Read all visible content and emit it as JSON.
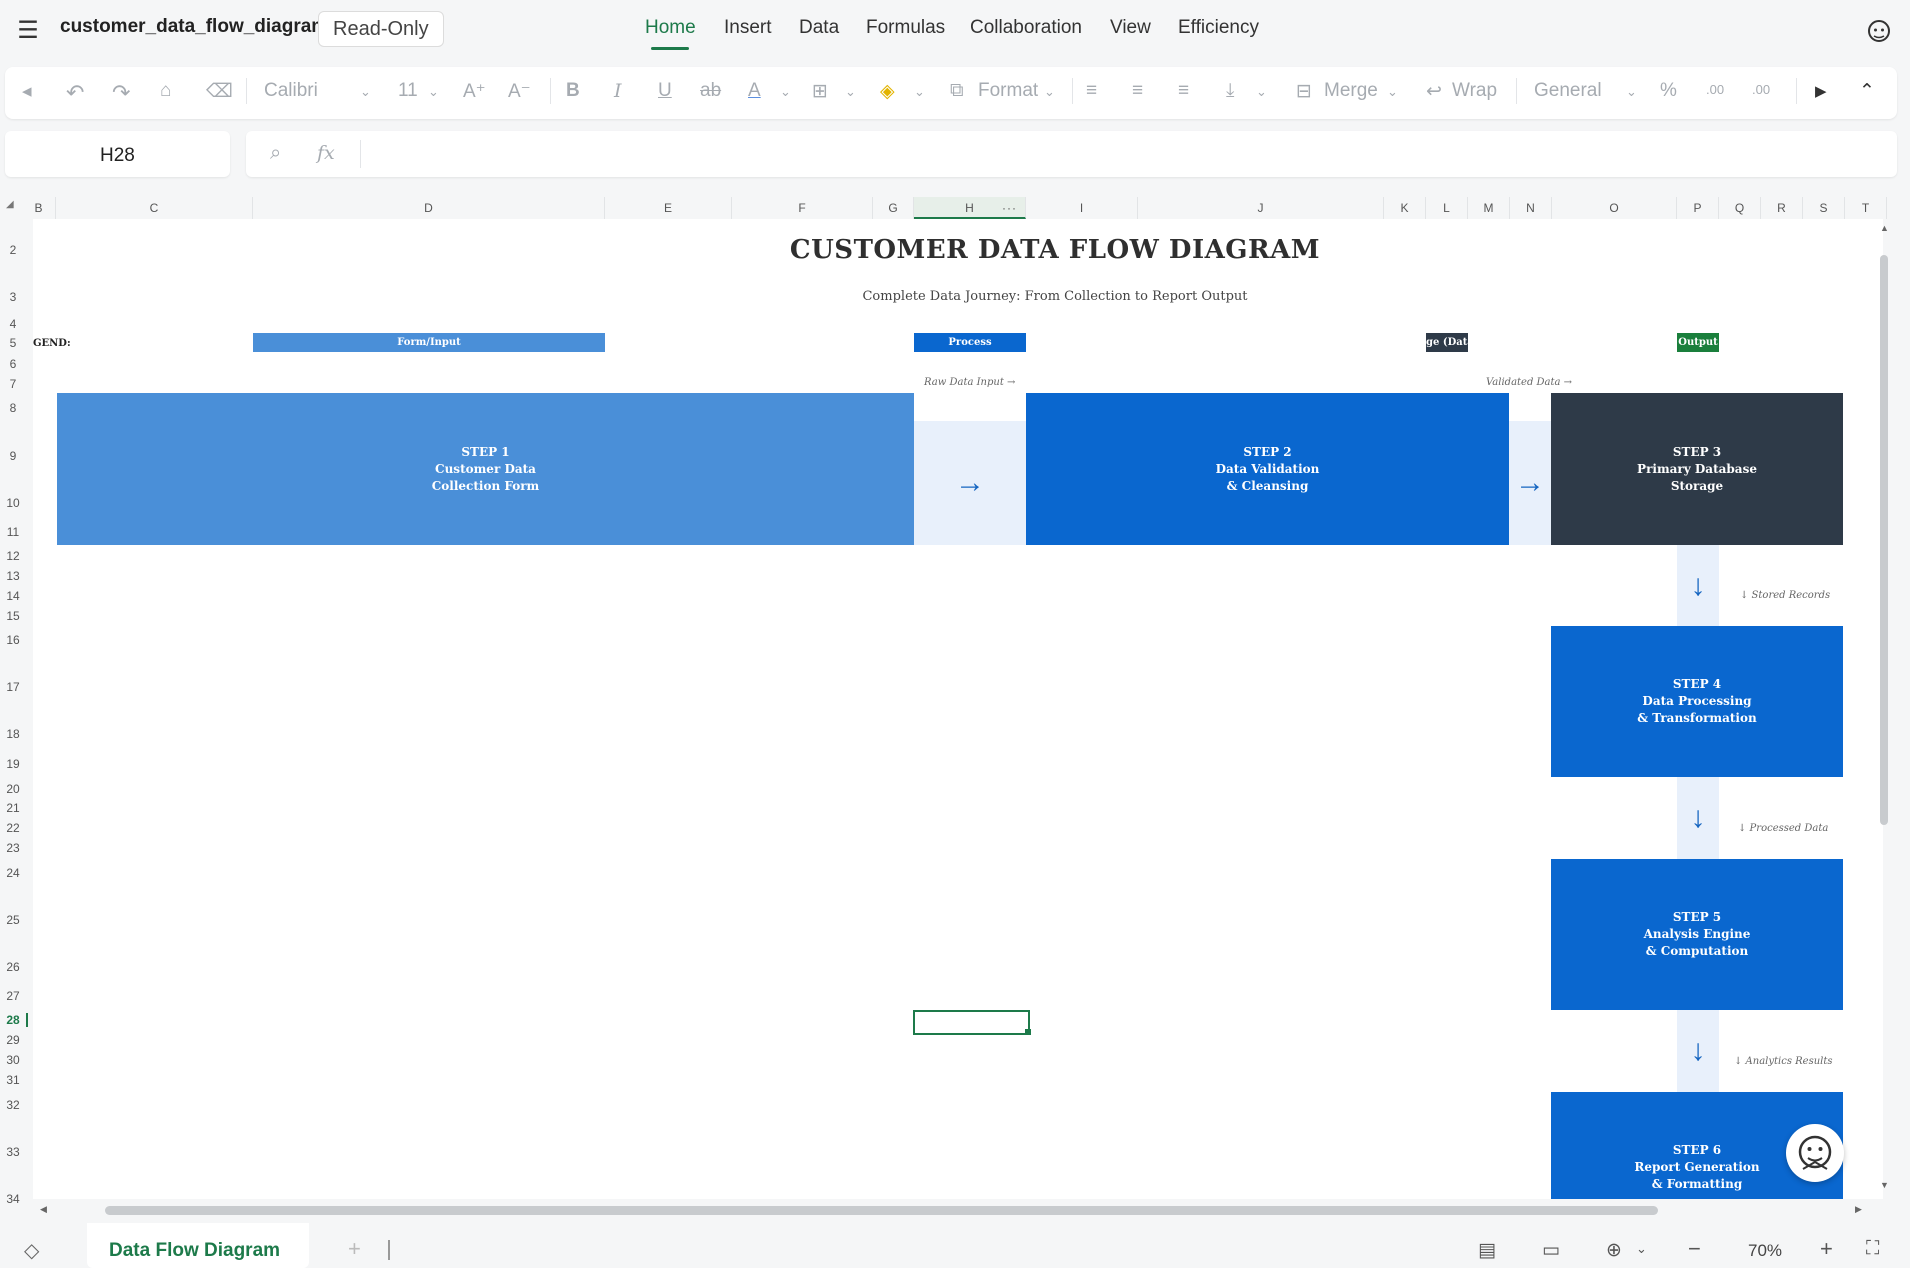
{
  "app": {
    "file_name": "customer_data_flow_diagram",
    "read_only_badge": "Read-Only",
    "menu": [
      "Home",
      "Insert",
      "Data",
      "Formulas",
      "Collaboration",
      "View",
      "Efficiency"
    ],
    "accent_color": "#1d7a4a"
  },
  "toolbar": {
    "font_name": "Calibri",
    "font_size": "11",
    "format_label": "Format",
    "merge_label": "Merge",
    "wrap_label": "Wrap",
    "number_format": "General"
  },
  "formula_bar": {
    "cell_ref": "H28",
    "fx_label": "fx",
    "formula": ""
  },
  "grid": {
    "columns": [
      "B",
      "C",
      "D",
      "E",
      "F",
      "G",
      "H",
      "I",
      "J",
      "K",
      "L",
      "M",
      "N",
      "O",
      "P",
      "Q",
      "R",
      "S",
      "T"
    ],
    "rows": [
      "2",
      "3",
      "4",
      "5",
      "6",
      "7",
      "8",
      "9",
      "10",
      "11",
      "12",
      "13",
      "14",
      "15",
      "16",
      "17",
      "18",
      "19",
      "20",
      "21",
      "22",
      "23",
      "24",
      "25",
      "26",
      "27",
      "28",
      "29",
      "30",
      "31",
      "32",
      "33",
      "34"
    ]
  },
  "diagram": {
    "title": "CUSTOMER DATA FLOW DIAGRAM",
    "subtitle": "Complete Data Journey: From Collection to Report Output",
    "legend_label": "GEND:",
    "legend": [
      {
        "label": "Form/Input",
        "color": "#4a8fd8"
      },
      {
        "label": "Process",
        "color": "#0a67cf"
      },
      {
        "label": "ge (Data",
        "color": "#2e3a48"
      },
      {
        "label": "Output",
        "color": "#1a7f3c"
      }
    ],
    "flow_labels": {
      "raw_input": "Raw Data Input →",
      "validated": "Validated Data →",
      "stored": "↓ Stored Records",
      "processed": "↓ Processed Data",
      "analytics": "↓ Analytics Results"
    },
    "steps": [
      {
        "num": "STEP 1",
        "line1": "Customer Data",
        "line2": "Collection Form",
        "color": "#4a8fd8"
      },
      {
        "num": "STEP 2",
        "line1": "Data Validation",
        "line2": "& Cleansing",
        "color": "#0a67cf"
      },
      {
        "num": "STEP 3",
        "line1": "Primary Database",
        "line2": "Storage",
        "color": "#2e3a48"
      },
      {
        "num": "STEP 4",
        "line1": "Data Processing",
        "line2": "& Transformation",
        "color": "#0a67cf"
      },
      {
        "num": "STEP 5",
        "line1": "Analysis Engine",
        "line2": "& Computation",
        "color": "#0a67cf"
      },
      {
        "num": "STEP 6",
        "line1": "Report Generation",
        "line2": "& Formatting",
        "color": "#0a67cf"
      }
    ],
    "arrow_right": "→",
    "arrow_down": "↓"
  },
  "sheet_tabs": {
    "active": "Data Flow Diagram",
    "add": "+"
  },
  "status": {
    "zoom": "70%"
  }
}
